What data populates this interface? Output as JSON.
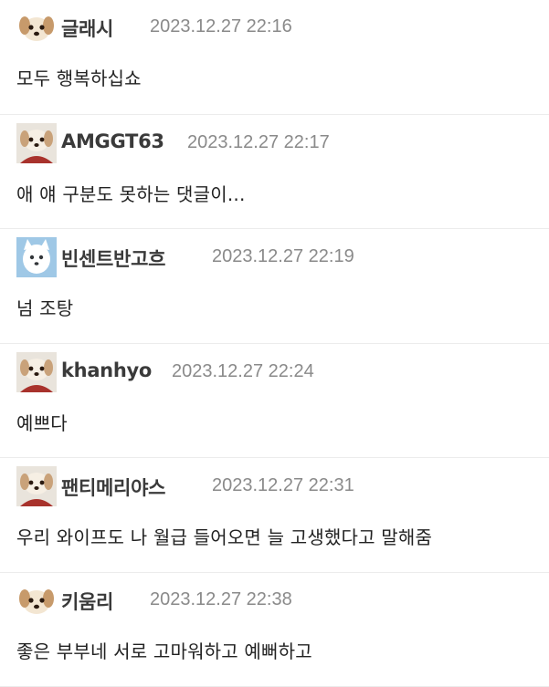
{
  "comments": [
    {
      "nickname": "글래시",
      "date": "2023.12.27 22:16",
      "text": "모두 행복하십쇼",
      "avatar_icon": "puppy-avatar-icon"
    },
    {
      "nickname": "AMGGT63",
      "date": "2023.12.27 22:17",
      "text": "애 얘 구분도 못하는 댓글이...",
      "avatar_icon": "puppy-scarf-avatar-icon"
    },
    {
      "nickname": "빈센트반고흐",
      "date": "2023.12.27 22:19",
      "text": "넘 조탕",
      "avatar_icon": "white-dog-avatar-icon"
    },
    {
      "nickname": "khanhyo",
      "date": "2023.12.27 22:24",
      "text": "예쁘다",
      "avatar_icon": "puppy-scarf-avatar-icon"
    },
    {
      "nickname": "팬티메리야스",
      "date": "2023.12.27 22:31",
      "text": "우리 와이프도 나 월급 들어오면 늘 고생했다고 말해줌",
      "avatar_icon": "puppy-scarf-avatar-icon"
    },
    {
      "nickname": "키움리",
      "date": "2023.12.27 22:38",
      "text": "좋은 부부네 서로 고마워하고 예뻐하고",
      "avatar_icon": "puppy-avatar-icon"
    }
  ],
  "colors": {
    "nickname": "#3a3a3a",
    "date": "#8a8a8a",
    "text": "#222222",
    "divider": "#ececec"
  }
}
